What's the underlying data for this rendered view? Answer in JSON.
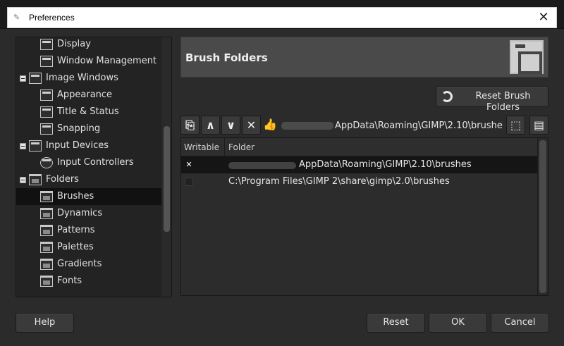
{
  "window": {
    "title": "Preferences",
    "close_glyph": "✕",
    "app_icon": "gimp-icon"
  },
  "sidebar": {
    "items": [
      {
        "label": "Display",
        "icon": "display-icon",
        "level": 1
      },
      {
        "label": "Window Management",
        "icon": "window-management-icon",
        "level": 1
      },
      {
        "label": "Image Windows",
        "icon": "image-windows-icon",
        "level": 0,
        "expanded": true
      },
      {
        "label": "Appearance",
        "icon": "appearance-icon",
        "level": 1
      },
      {
        "label": "Title & Status",
        "icon": "title-status-icon",
        "level": 1
      },
      {
        "label": "Snapping",
        "icon": "snapping-icon",
        "level": 1
      },
      {
        "label": "Input Devices",
        "icon": "input-devices-icon",
        "level": 0,
        "expanded": true
      },
      {
        "label": "Input Controllers",
        "icon": "input-controllers-icon",
        "level": 1
      },
      {
        "label": "Folders",
        "icon": "folders-icon",
        "level": 0,
        "expanded": true
      },
      {
        "label": "Brushes",
        "icon": "brushes-folder-icon",
        "level": 1,
        "selected": true
      },
      {
        "label": "Dynamics",
        "icon": "dynamics-folder-icon",
        "level": 1
      },
      {
        "label": "Patterns",
        "icon": "patterns-folder-icon",
        "level": 1
      },
      {
        "label": "Palettes",
        "icon": "palettes-folder-icon",
        "level": 1
      },
      {
        "label": "Gradients",
        "icon": "gradients-folder-icon",
        "level": 1
      },
      {
        "label": "Fonts",
        "icon": "fonts-folder-icon",
        "level": 1
      }
    ]
  },
  "panel": {
    "title": "Brush Folders",
    "header_icon": "brush-folder-icon",
    "reset_folders_label": "Reset Brush Folders",
    "path_value": "AppData\\Roaming\\GIMP\\2.10\\brushes",
    "toolbar": {
      "new_icon": "new-folder-icon",
      "up_icon": "move-up-icon",
      "down_icon": "move-down-icon",
      "delete_icon": "delete-icon",
      "writable_icon": "thumbs-up-icon",
      "browse_icon": "open-folder-icon",
      "browse2_icon": "file-chooser-icon"
    }
  },
  "folders_table": {
    "columns": [
      "Writable",
      "Folder"
    ],
    "rows": [
      {
        "writable": true,
        "folder": "AppData\\Roaming\\GIMP\\2.10\\brushes",
        "selected": true
      },
      {
        "writable": false,
        "folder": "C:\\Program Files\\GIMP 2\\share\\gimp\\2.0\\brushes",
        "selected": false
      }
    ]
  },
  "buttons": {
    "help": "Help",
    "reset": "Reset",
    "ok": "OK",
    "cancel": "Cancel"
  }
}
